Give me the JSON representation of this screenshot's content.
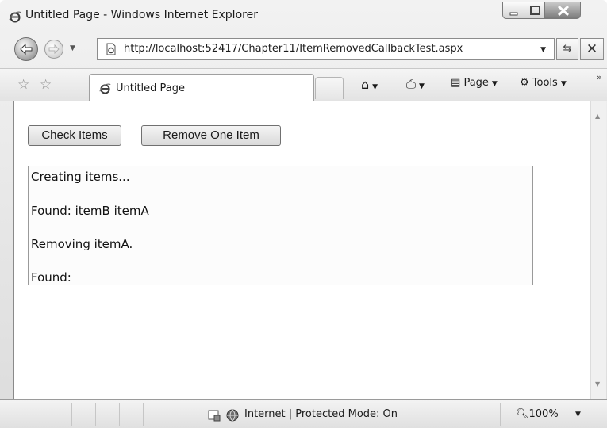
{
  "window": {
    "title": "Untitled Page - Windows Internet Explorer"
  },
  "address_bar": {
    "url": "http://localhost:52417/Chapter11/ItemRemovedCallbackTest.aspx"
  },
  "tabs": [
    {
      "label": "Untitled Page"
    }
  ],
  "command_bar": {
    "page_label": "Page",
    "tools_label": "Tools"
  },
  "page": {
    "buttons": {
      "check_items": "Check Items",
      "remove_one_item": "Remove One Item"
    },
    "log_lines": [
      "Creating items...",
      "Found: itemB itemA",
      "Removing itemA.",
      "Found:"
    ]
  },
  "status_bar": {
    "zone": "Internet | Protected Mode: On",
    "zoom": "100%"
  }
}
